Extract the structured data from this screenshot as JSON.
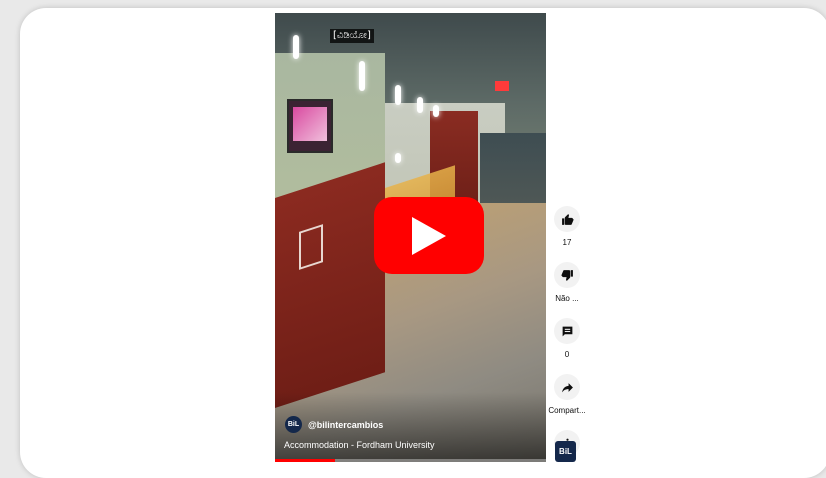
{
  "video": {
    "timestamp_label": "[ವಿಡಿಯೋ]",
    "channel": {
      "avatar_text": "BiL",
      "handle": "@bilintercambios"
    },
    "title": "Accommodation - Fordham University",
    "progress_fraction": 0.22
  },
  "actions": {
    "like": {
      "icon": "thumbs-up-icon",
      "label": "17"
    },
    "dislike": {
      "icon": "thumbs-down-icon",
      "label": "Não ..."
    },
    "comments": {
      "icon": "comment-icon",
      "label": "0"
    },
    "share": {
      "icon": "share-icon",
      "label": "Compart..."
    },
    "more": {
      "icon": "more-vertical-icon"
    }
  },
  "bottom_avatar": {
    "text": "BiL"
  },
  "colors": {
    "play_red": "#ff0000",
    "avatar_navy": "#14284b"
  }
}
